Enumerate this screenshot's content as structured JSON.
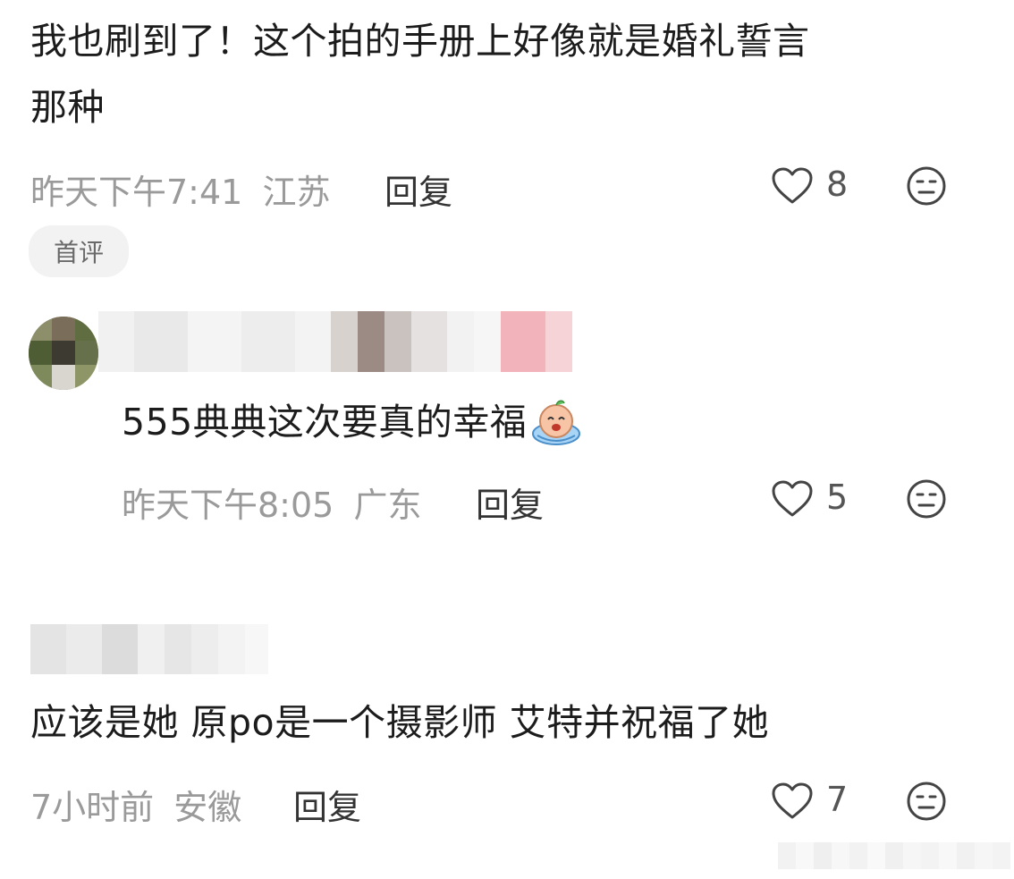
{
  "comments": [
    {
      "text_line1": "我也刷到了！这个拍的手册上好像就是婚礼誓言",
      "text_line2": "那种",
      "time": "昨天下午7:41",
      "location": "江苏",
      "reply_label": "回复",
      "likes": "8",
      "badge": "首评"
    },
    {
      "text": "555典典这次要真的幸福",
      "time": "昨天下午8:05",
      "location": "广东",
      "reply_label": "回复",
      "likes": "5"
    },
    {
      "text": "应该是她 原po是一个摄影师 艾特并祝福了她",
      "time": "7小时前",
      "location": "安徽",
      "reply_label": "回复",
      "likes": "7"
    }
  ],
  "icons": {
    "like": "heart-outline-icon",
    "dislike": "meh-face-icon",
    "emoji": "crying-face-emoji"
  },
  "colors": {
    "text": "#1c1c1c",
    "meta": "#9a9a9a",
    "reply": "#333333",
    "badge_bg": "#f2f2f2"
  }
}
